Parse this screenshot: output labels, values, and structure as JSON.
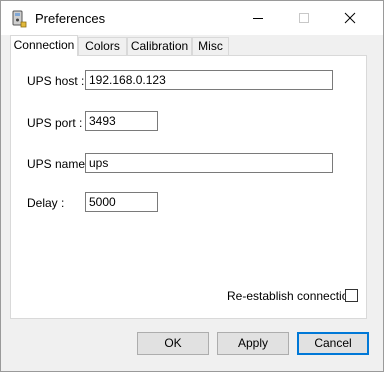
{
  "window": {
    "title": "Preferences",
    "icon": "ups-app-icon",
    "controls": {
      "minimize": "minimize-icon",
      "maximize": "maximize-icon",
      "close": "close-icon"
    }
  },
  "tabs": [
    {
      "label": "Connection",
      "active": true
    },
    {
      "label": "Colors",
      "active": false
    },
    {
      "label": "Calibration",
      "active": false
    },
    {
      "label": "Misc",
      "active": false
    }
  ],
  "form": {
    "host_label": "UPS host :",
    "host_value": "192.168.0.123",
    "port_label": "UPS port :",
    "port_value": "3493",
    "name_label": "UPS name :",
    "name_value": "ups",
    "delay_label": "Delay :",
    "delay_value": "5000",
    "reconnect_label": "Re-establish connection",
    "reconnect_checked": false
  },
  "buttons": {
    "ok": "OK",
    "apply": "Apply",
    "cancel": "Cancel"
  },
  "colors": {
    "accent": "#0078d7",
    "background": "#f0f0f0",
    "panel": "#ffffff"
  }
}
